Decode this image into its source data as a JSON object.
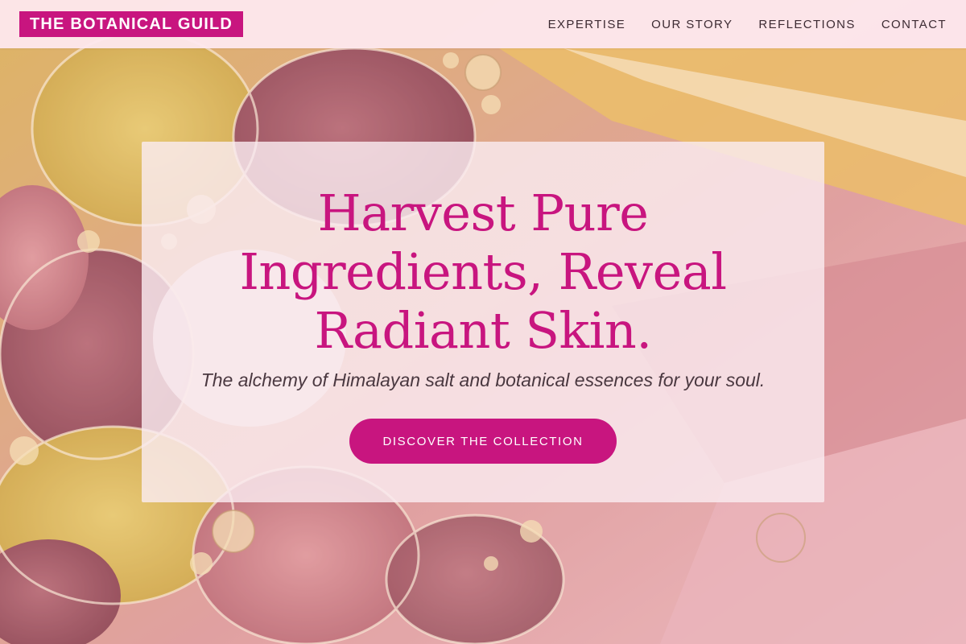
{
  "brand": {
    "name": "THE BOTANICAL GUILD",
    "accent_color": "#c8157f"
  },
  "nav": {
    "items": [
      {
        "label": "EXPERTISE"
      },
      {
        "label": "OUR STORY"
      },
      {
        "label": "REFLECTIONS"
      },
      {
        "label": "CONTACT"
      }
    ]
  },
  "hero": {
    "headline_lines": [
      "Harvest Pure",
      "Ingredients, Reveal",
      "Radiant Skin."
    ],
    "tagline": "The alchemy of Himalayan salt and botanical essences for your soul.",
    "cta_label": "DISCOVER THE COLLECTION",
    "background": "oil-bubbles-image"
  }
}
